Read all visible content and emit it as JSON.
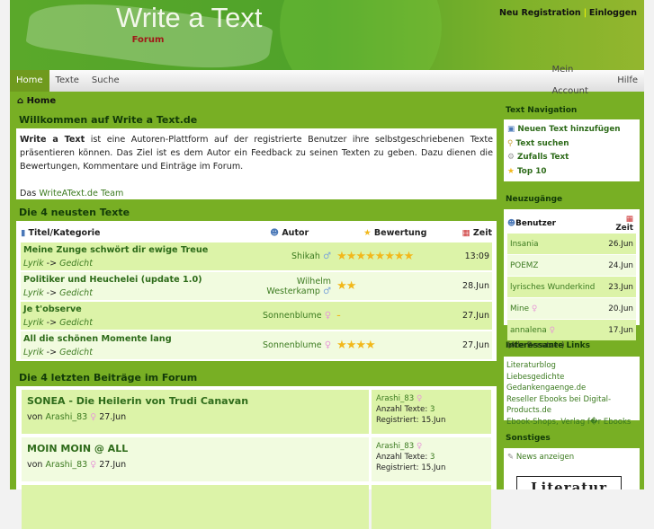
{
  "header": {
    "logo": "Write a Text",
    "register": "Neu Registration",
    "login": "Einloggen",
    "sep": "|"
  },
  "nav": [
    "Home",
    "Texte",
    "Suche",
    "Forum",
    "Mein Account",
    "Hilfe"
  ],
  "breadcrumb": "Home",
  "welcome": {
    "title": "Willkommen auf Write a Text.de",
    "brand": "Write a Text",
    "body": " ist eine Autoren-Plattform auf der registrierte Benutzer ihre selbstgeschriebenen Texte präsentieren können. Das Ziel ist es dem Autor ein Feedback zu seinen Texten zu geben. Dazu dienen die Bewertungen, Kommentare und Einträge im Forum.",
    "sign_prefix": "Das ",
    "sign_link": "WriteAText.de Team"
  },
  "texts": {
    "title": "Die 4 neusten Texte",
    "cols": [
      "Titel/Kategorie",
      "Autor",
      "Bewertung",
      "Zeit"
    ],
    "rows": [
      {
        "title": "Meine Zunge schwört dir ewige Treue",
        "cat1": "Lyrik",
        "arrow": "->",
        "cat2": "Gedicht",
        "author": "Shikah",
        "gender": "♂",
        "stars": "★★★★★★★★",
        "time": "13:09"
      },
      {
        "title": "Politiker und Heuchelei (update 1.0)",
        "cat1": "Lyrik",
        "arrow": "->",
        "cat2": "Gedicht",
        "author": "Wilhelm Westerkamp",
        "gender": "♂",
        "stars": "★★",
        "time": "28.Jun"
      },
      {
        "title": "Je t'observe",
        "cat1": "Lyrik",
        "arrow": "->",
        "cat2": "Gedicht",
        "author": "Sonnenblume",
        "gender": "♀",
        "stars": "-",
        "time": "27.Jun"
      },
      {
        "title": "All die schönen Momente lang",
        "cat1": "Lyrik",
        "arrow": "->",
        "cat2": "Gedicht",
        "author": "Sonnenblume",
        "gender": "♀",
        "stars": "★★★★",
        "time": "27.Jun"
      }
    ]
  },
  "forum": {
    "title": "Die 4 letzten Beiträge im Forum",
    "posts": [
      {
        "title": "SONEA - Die Heilerin von Trudi Canavan",
        "by": "von",
        "user": "Arashi_83",
        "date": "27.Jun",
        "count_label": "Anzahl Texte:",
        "count": "3",
        "reg_label": "Registriert:",
        "reg": "15.Jun"
      },
      {
        "title": "MOIN MOIN @ ALL",
        "by": "von",
        "user": "Arashi_83",
        "date": "27.Jun",
        "count_label": "Anzahl Texte:",
        "count": "3",
        "reg_label": "Registriert:",
        "reg": "15.Jun"
      }
    ]
  },
  "sidebar": {
    "textnav": {
      "title": "Text Navigation",
      "items": [
        "Neuen Text hinzufügen",
        "Text suchen",
        "Zufalls Text",
        "Top 10"
      ]
    },
    "neu": {
      "title": "Neuzugänge",
      "col_user": "Benutzer",
      "col_time": "Zeit",
      "rows": [
        {
          "user": "Insania",
          "time": "26.Jun"
        },
        {
          "user": "POEMZ",
          "time": "24.Jun"
        },
        {
          "user": "lyrisches Wunderkind",
          "time": "23.Jun"
        },
        {
          "user": "Mine",
          "time": "20.Jun",
          "gender": "♀"
        },
        {
          "user": "annalena",
          "time": "17.Jun",
          "gender": "♀"
        }
      ],
      "all": "(Alle Benutzer)"
    },
    "links": {
      "title": "Interessante Links",
      "items": [
        "Literaturblog",
        "Liebesgedichte Gedankengaenge.de",
        "Reseller Ebooks bei Digital-Products.de",
        "Ebook-Shops, Verlag f�r Ebooks"
      ]
    },
    "misc": {
      "title": "Sonstiges",
      "news": "News anzeigen",
      "banner": "Literatur"
    }
  }
}
